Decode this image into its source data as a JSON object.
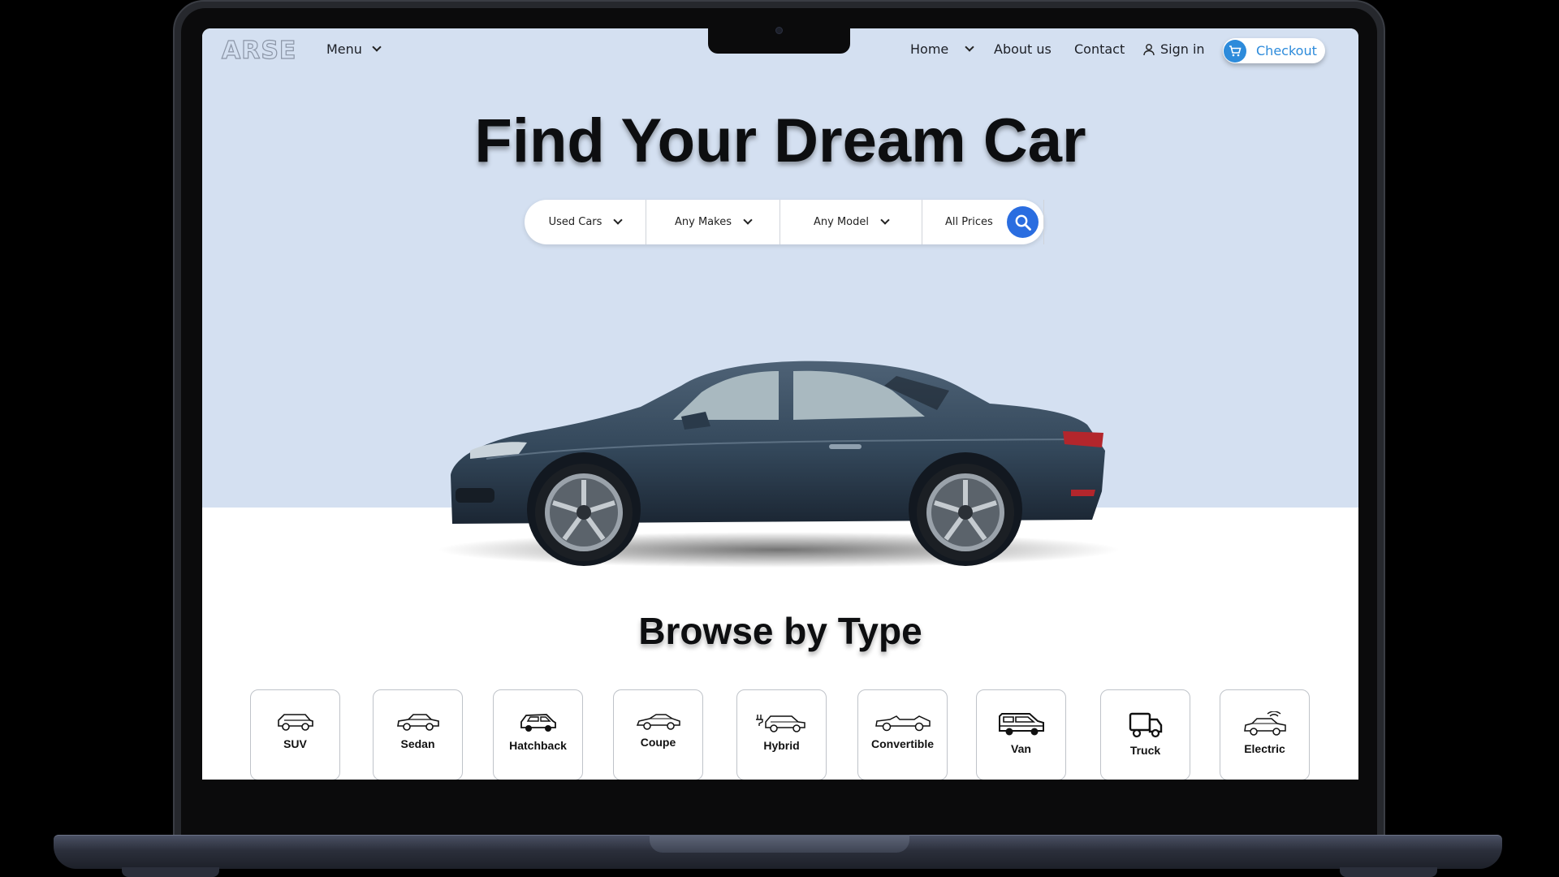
{
  "header": {
    "logo": "ARSE",
    "menu_label": "Menu",
    "nav": {
      "home": "Home",
      "about": "About us",
      "contact": "Contact",
      "signin": "Sign in",
      "checkout": "Checkout"
    }
  },
  "hero": {
    "headline": "Find Your Dream Car",
    "search": {
      "condition": "Used Cars",
      "make": "Any Makes",
      "model": "Any Model",
      "price": "All Prices"
    }
  },
  "browse": {
    "title": "Browse by Type",
    "types": [
      {
        "label": "SUV",
        "icon": "suv-icon"
      },
      {
        "label": "Sedan",
        "icon": "sedan-icon"
      },
      {
        "label": "Hatchback",
        "icon": "hatchback-icon"
      },
      {
        "label": "Coupe",
        "icon": "coupe-icon"
      },
      {
        "label": "Hybrid",
        "icon": "hybrid-icon"
      },
      {
        "label": "Convertible",
        "icon": "convertible-icon"
      },
      {
        "label": "Van",
        "icon": "van-icon"
      },
      {
        "label": "Truck",
        "icon": "truck-icon"
      },
      {
        "label": "Electric",
        "icon": "electric-icon"
      }
    ]
  },
  "colors": {
    "hero_bg": "#d4e0f1",
    "accent": "#2a6de0",
    "checkout": "#2d8bdb",
    "car_body": "#33475a"
  }
}
